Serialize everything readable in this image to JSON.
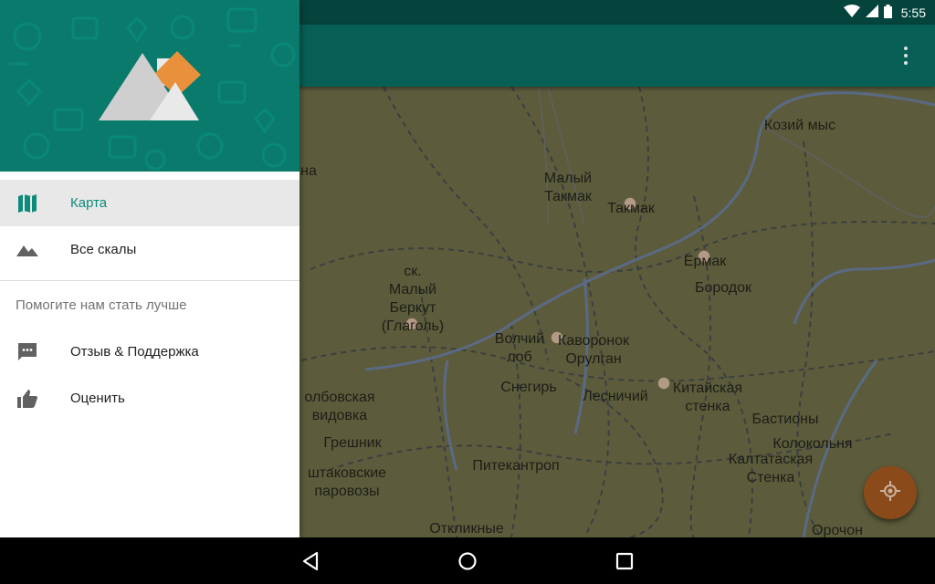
{
  "status_bar": {
    "time": "5:55",
    "icons": [
      "wifi-icon",
      "signal-icon",
      "battery-icon"
    ]
  },
  "toolbar": {
    "overflow_icon": "more-vert-icon"
  },
  "drawer": {
    "items": [
      {
        "label": "Карта",
        "icon": "map-icon",
        "active": true
      },
      {
        "label": "Все скалы",
        "icon": "terrain-icon",
        "active": false
      }
    ],
    "section_header": "Помогите нам стать лучше",
    "secondary_items": [
      {
        "label": "Отзыв & Поддержка",
        "icon": "feedback-icon"
      },
      {
        "label": "Оценить",
        "icon": "thumb-up-icon"
      }
    ]
  },
  "map": {
    "labels": [
      "Козий мыс",
      "Малый\nТакмак",
      "Такмак",
      "Ермак",
      "Бородок",
      "ск.\nМалый\nБеркут\n(Глаголь)",
      "Волчий\nлоб",
      "Каворонок\nОрулган",
      "Снегирь",
      "Лесничий",
      "Китайская\nстенка",
      "Бастионы",
      "Колокольня",
      "Калтатаская\nСтенка",
      "олбовская\nвидовка",
      "Грешник",
      "штаковские\nпаровозы",
      "Питекантроп",
      "Откликные",
      "Орочон",
      "на"
    ]
  },
  "colors": {
    "accent": "#0d8b7a",
    "toolbar": "#075f55",
    "status_bar": "#05443c",
    "fab": "#8b4a19",
    "map_bg": "#5c5c3c"
  },
  "fab": {
    "icon": "my-location-icon"
  },
  "navigation": {
    "icons": [
      "back-icon",
      "home-icon",
      "recents-icon"
    ]
  }
}
